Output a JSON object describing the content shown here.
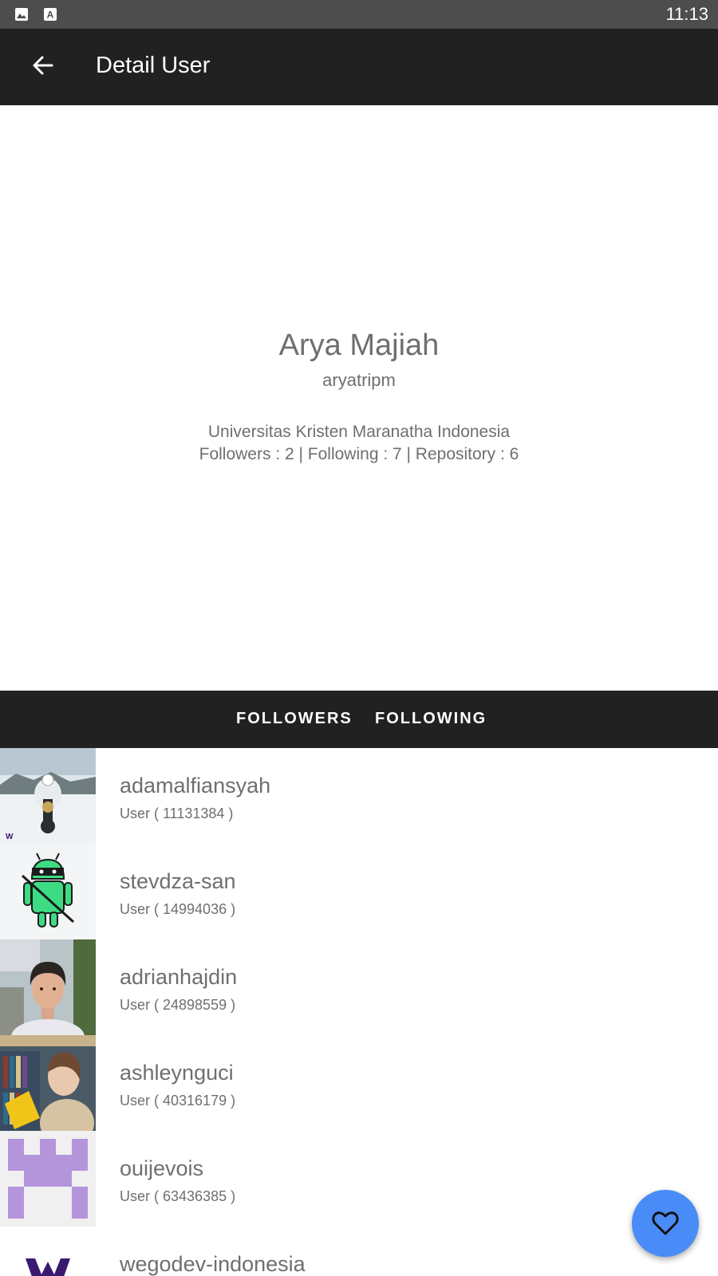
{
  "status_bar": {
    "time": "11:13",
    "icons": [
      "image-notification-icon",
      "text-notification-icon"
    ]
  },
  "app_bar": {
    "title": "Detail User",
    "back_icon": "arrow-back-icon"
  },
  "profile": {
    "name": "Arya Majiah",
    "login": "aryatripm",
    "company": "Universitas Kristen Maranatha Indonesia",
    "stats": "Followers : 2 | Following : 7 | Repository : 6"
  },
  "tabs": [
    {
      "label": "FOLLOWERS",
      "selected": true
    },
    {
      "label": "FOLLOWING",
      "selected": false
    }
  ],
  "users": [
    {
      "login": "adamalfiansyah",
      "subtitle": "User ( 11131384 )",
      "avatar": "motorcycle-rider-photo"
    },
    {
      "login": "stevdza-san",
      "subtitle": "User ( 14994036 )",
      "avatar": "android-ninja-illustration"
    },
    {
      "login": "adrianhajdin",
      "subtitle": "User ( 24898559 )",
      "avatar": "portrait-photo"
    },
    {
      "login": "ashleynguci",
      "subtitle": "User ( 40316179 )",
      "avatar": "library-photo"
    },
    {
      "login": "ouijevois",
      "subtitle": "User ( 63436385 )",
      "avatar": "identicon-purple"
    },
    {
      "login": "wegodev-indonesia",
      "subtitle": "",
      "avatar": "w-logo"
    }
  ],
  "fab": {
    "icon": "heart-outline-icon"
  },
  "colors": {
    "status_bar": "#4d4d4d",
    "app_bar": "#212121",
    "tab_bar": "#212121",
    "text_secondary": "#6f6f6f",
    "fab": "#4a8cf7",
    "identicon": "#b495dc"
  }
}
